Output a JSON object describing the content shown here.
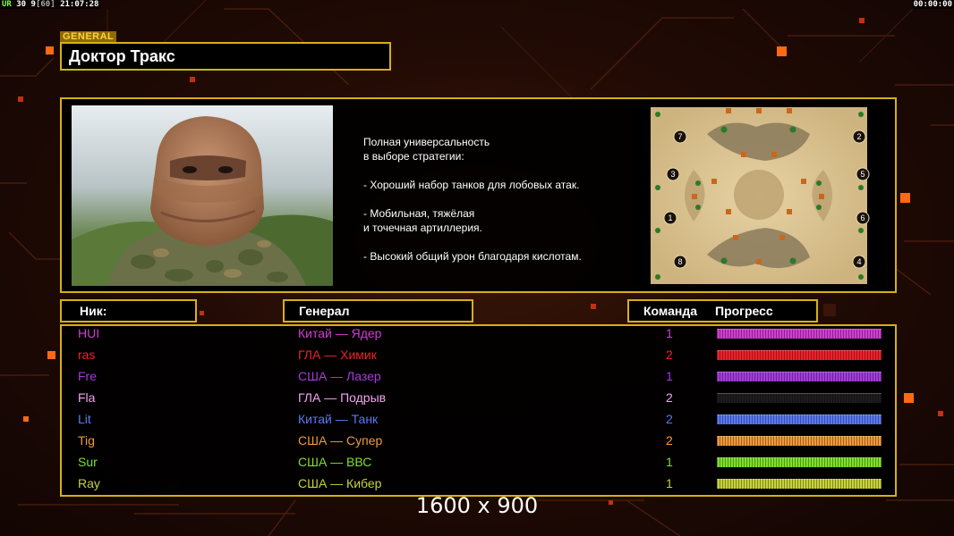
{
  "hud": {
    "ur": "UR",
    "fps": "30",
    "fps_target": "9",
    "fps_cap": "60",
    "clock": "21:07:28",
    "timer": "00:00:00"
  },
  "header": {
    "tag": "GENERAL",
    "general_name": "Доктор Тракс"
  },
  "description": "Полная универсальность\nв выборе стратегии:\n\n- Хороший набор танков для лобовых атак.\n\n- Мобильная, тяжёлая\nи точечная артиллерия.\n\n- Высокий общий урон благодаря кислотам.",
  "map": {
    "start_positions": [
      "7",
      "2",
      "3",
      "5",
      "1",
      "6",
      "8",
      "4"
    ]
  },
  "columns": {
    "nick": "Ник:",
    "general": "Генерал",
    "team": "Команда",
    "progress": "Прогресс"
  },
  "players": [
    {
      "nick": "HUI",
      "general": "Китай — Ядер",
      "team": "1",
      "color": "#d23cd4",
      "progress": 1.0
    },
    {
      "nick": "ras",
      "general": "ГЛА — Химик",
      "team": "2",
      "color": "#f0202a",
      "progress": 1.0
    },
    {
      "nick": "Fre",
      "general": "США — Лазер",
      "team": "1",
      "color": "#a53ae0",
      "progress": 1.0
    },
    {
      "nick": "Fla",
      "general": "ГЛА — Подрыв",
      "team": "2",
      "color": "#f2a4ef",
      "progress": 0.0
    },
    {
      "nick": "Lit",
      "general": "Китай — Танк",
      "team": "2",
      "color": "#5a78f4",
      "progress": 1.0
    },
    {
      "nick": "Tig",
      "general": "США — Супер",
      "team": "2",
      "color": "#f09a3a",
      "progress": 1.0
    },
    {
      "nick": "Sur",
      "general": "США — ВВС",
      "team": "1",
      "color": "#7ee02a",
      "progress": 1.0
    },
    {
      "nick": "Ray",
      "general": "США — Кибер",
      "team": "1",
      "color": "#c8d23a",
      "progress": 1.0
    }
  ],
  "resolution_label": "1600 x 900",
  "colors": {
    "frame": "#d6b016",
    "accent": "#ff7a10"
  }
}
